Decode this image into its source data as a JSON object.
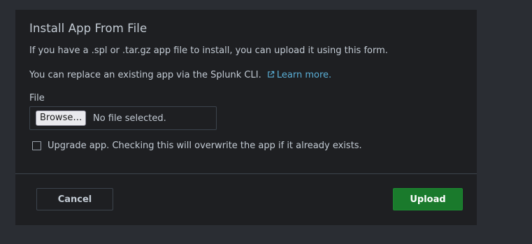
{
  "modal": {
    "title": "Install App From File",
    "intro": "If you have a .spl or .tar.gz app file to install, you can upload it using this form.",
    "cli_text": "You can replace an existing app via the Splunk CLI.",
    "learn_more": "Learn more.",
    "file_label": "File",
    "browse_label": "Browse…",
    "no_file_text": "No file selected.",
    "upgrade_label": "Upgrade app. Checking this will overwrite the app if it already exists.",
    "upgrade_checked": false,
    "cancel_label": "Cancel",
    "upload_label": "Upload"
  },
  "icons": {
    "learn_more": "external-link-icon"
  },
  "colors": {
    "background": "#2a2d33",
    "modal_background": "#1e1f22",
    "text": "#c3cbd4",
    "link": "#5bb0d8",
    "upload_button": "#1a7a2c",
    "border": "#3c444d"
  }
}
